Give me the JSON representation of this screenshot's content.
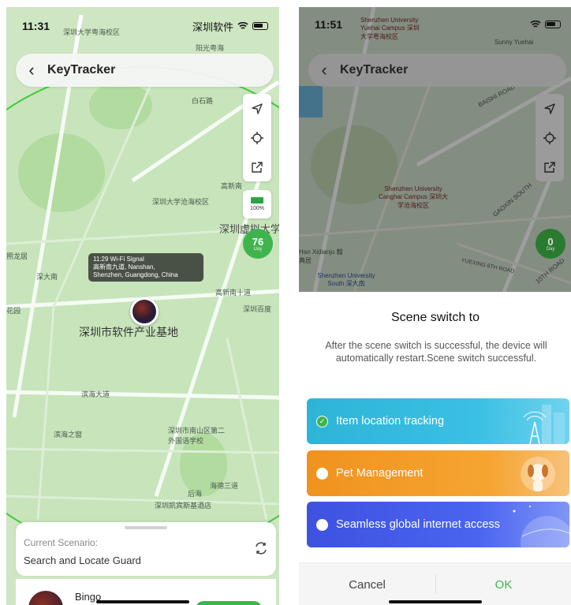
{
  "left": {
    "status_time": "11:31",
    "status_carrier_label": "深圳软件",
    "title": "KeyTracker",
    "battery_pct": "100%",
    "day_badge": {
      "num": "76",
      "unit": "Day"
    },
    "info_bubble": {
      "line1": "11:29 Wi-Fi Signal",
      "line2": "高新南九道, Nanshan,",
      "line3": "Shenzhen, Guangdong, China"
    },
    "map_labels": {
      "shenzhen_univ": "深圳大学粤海校区",
      "yangguang": "阳光粤海",
      "baishilu": "白石路",
      "gaoxinnan": "高新南",
      "canghai": "深圳大学沧海校区",
      "shenzhen_xuni": "深圳虚拟大学",
      "zhaolongju": "照龙居",
      "shendanan": "深大南",
      "huayuan": "花园",
      "gaoxinnanshi": "高新南十道",
      "shenzhenbaidu": "深圳百度",
      "software_base": "深圳市软件产业基地",
      "binhaidadao": "滨海大道",
      "binhaizhilu": "滨海之窗",
      "nanshanlu": "深圳市南山区第二外国语学校",
      "houhai": "后海",
      "haide": "海德三道",
      "kempinski": "深圳凯宾斯基酒店"
    },
    "current_scenario_label": "Current Scenario:",
    "current_scenario_value": "Search and Locate Guard",
    "device_name": "Bingo"
  },
  "right": {
    "status_time": "11:51",
    "title": "KeyTracker",
    "day_badge": {
      "num": "0",
      "unit": "Day"
    },
    "map_labels": {
      "szu": "Shenzhen University Yuehai Campus 深圳大学粤海校区",
      "sunny": "Sunny Yuehai",
      "baishi": "BAISHI ROAD",
      "canghai": "Shenzhen University Canghai Campus 深圳大学沧海校区",
      "gaoxin": "GAOXIN SOUTH",
      "hanxidanju": "Han Xidianju 翰典居",
      "south": "Shenzhen University South 深大南",
      "yuexing": "YUEXING 6TH ROAD",
      "tenth": "10TH ROAD"
    },
    "sheet_title": "Scene switch to",
    "sheet_desc": "After the scene switch is successful, the device will automatically restart.Scene switch successful.",
    "options": [
      {
        "label": "Item location tracking",
        "checked": true,
        "color": "#2eb4d6"
      },
      {
        "label": "Pet Management",
        "checked": false,
        "color": "#f0921e"
      },
      {
        "label": "Seamless global internet access",
        "checked": false,
        "color": "#3d52e0"
      }
    ],
    "cancel_label": "Cancel",
    "ok_label": "OK"
  }
}
